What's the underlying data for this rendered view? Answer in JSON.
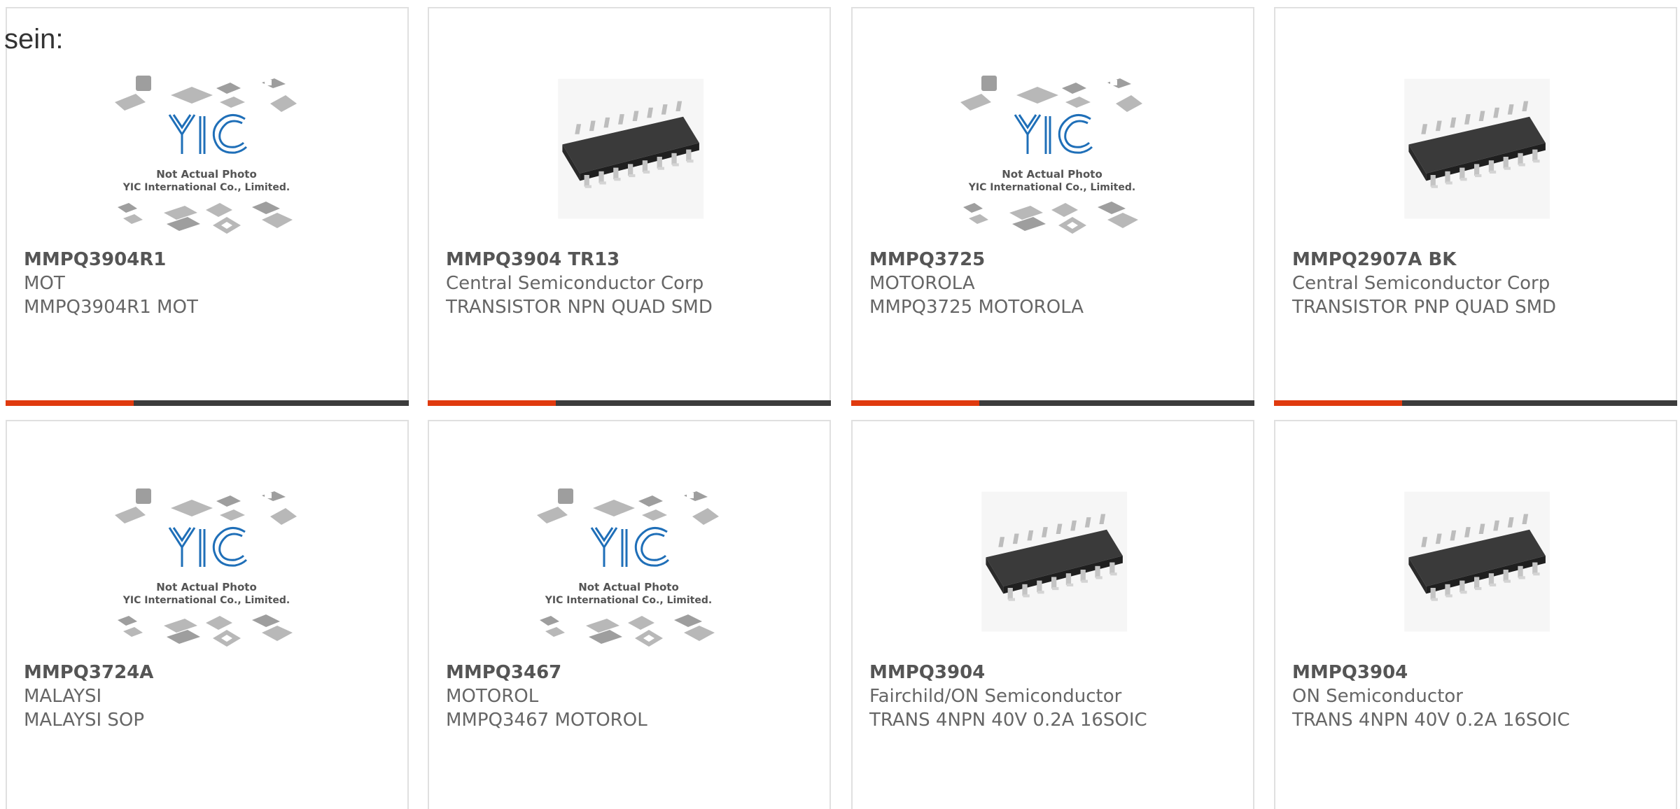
{
  "intro_text": "sein:",
  "accent_color": "#e03a0e",
  "bar_color": "#3c3c3c",
  "placeholder": {
    "caption_line1": "Not Actual Photo",
    "caption_line2": "YIC International Co., Limited."
  },
  "products": [
    {
      "part": "MMPQ3904R1",
      "maker": "MOT",
      "desc": "MMPQ3904R1 MOT",
      "image": "placeholder"
    },
    {
      "part": "MMPQ3904 TR13",
      "maker": "Central Semiconductor Corp",
      "desc": "TRANSISTOR NPN QUAD SMD",
      "image": "chip"
    },
    {
      "part": "MMPQ3725",
      "maker": "MOTOROLA",
      "desc": "MMPQ3725 MOTOROLA",
      "image": "placeholder"
    },
    {
      "part": "MMPQ2907A BK",
      "maker": "Central Semiconductor Corp",
      "desc": "TRANSISTOR PNP QUAD SMD",
      "image": "chip"
    },
    {
      "part": "MMPQ3724A",
      "maker": "MALAYSI",
      "desc": "MALAYSI SOP",
      "image": "placeholder"
    },
    {
      "part": "MMPQ3467",
      "maker": "MOTOROL",
      "desc": "MMPQ3467 MOTOROL",
      "image": "placeholder"
    },
    {
      "part": "MMPQ3904",
      "maker": "Fairchild/ON Semiconductor",
      "desc": "TRANS 4NPN 40V 0.2A 16SOIC",
      "image": "chip"
    },
    {
      "part": "MMPQ3904",
      "maker": "ON Semiconductor",
      "desc": "TRANS 4NPN 40V 0.2A 16SOIC",
      "image": "chip"
    }
  ]
}
